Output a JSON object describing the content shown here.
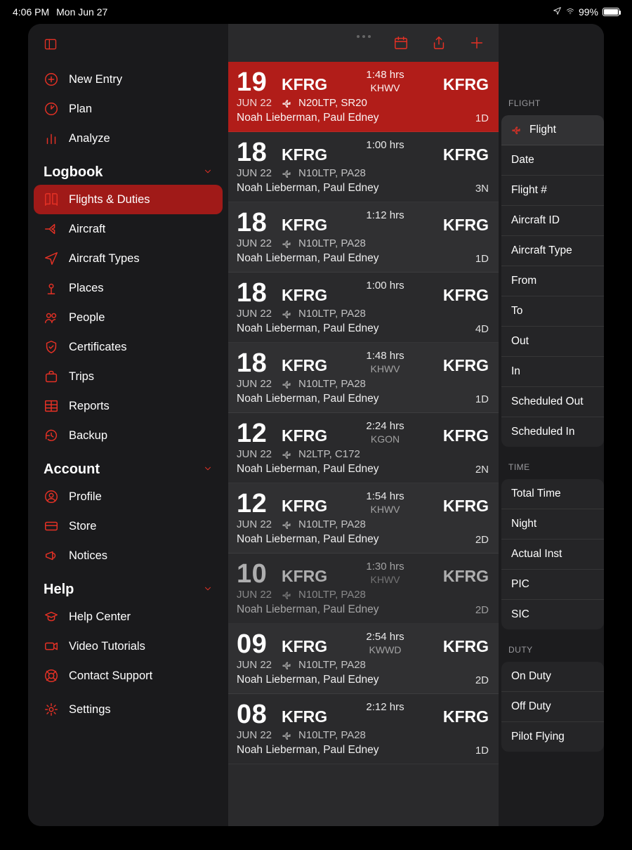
{
  "status": {
    "time": "4:06 PM",
    "date": "Mon Jun 27",
    "battery_pct": "99%"
  },
  "toolbar": {
    "calendar_icon": "calendar-icon",
    "share_icon": "share-icon",
    "add_icon": "plus-icon"
  },
  "sidebar": {
    "top_items": [
      {
        "icon": "add-circle-icon",
        "label": "New Entry"
      },
      {
        "icon": "gauge-icon",
        "label": "Plan"
      },
      {
        "icon": "bars-icon",
        "label": "Analyze"
      }
    ],
    "groups": [
      {
        "title": "Logbook",
        "items": [
          {
            "icon": "book-icon",
            "label": "Flights & Duties",
            "active": true
          },
          {
            "icon": "plane-icon",
            "label": "Aircraft"
          },
          {
            "icon": "paperplane-icon",
            "label": "Aircraft Types"
          },
          {
            "icon": "pin-icon",
            "label": "Places"
          },
          {
            "icon": "people-icon",
            "label": "People"
          },
          {
            "icon": "badge-icon",
            "label": "Certificates"
          },
          {
            "icon": "briefcase-icon",
            "label": "Trips"
          },
          {
            "icon": "table-icon",
            "label": "Reports"
          },
          {
            "icon": "history-icon",
            "label": "Backup"
          }
        ]
      },
      {
        "title": "Account",
        "items": [
          {
            "icon": "profile-icon",
            "label": "Profile"
          },
          {
            "icon": "card-icon",
            "label": "Store"
          },
          {
            "icon": "megaphone-icon",
            "label": "Notices"
          }
        ]
      },
      {
        "title": "Help",
        "items": [
          {
            "icon": "graduation-icon",
            "label": "Help Center"
          },
          {
            "icon": "video-icon",
            "label": "Video Tutorials"
          },
          {
            "icon": "lifebuoy-icon",
            "label": "Contact Support"
          }
        ]
      }
    ],
    "footer": [
      {
        "icon": "gear-icon",
        "label": "Settings"
      }
    ]
  },
  "flights": [
    {
      "day": "19",
      "month": "JUN 22",
      "origin": "KFRG",
      "dest": "KFRG",
      "duration": "1:48 hrs",
      "via": "KHWV",
      "aircraft": "N20LTP, SR20",
      "crew": "Noah Lieberman, Paul Edney",
      "tag": "1D",
      "selected": true
    },
    {
      "day": "18",
      "month": "JUN 22",
      "origin": "KFRG",
      "dest": "KFRG",
      "duration": "1:00 hrs",
      "via": "",
      "aircraft": "N10LTP, PA28",
      "crew": "Noah Lieberman, Paul Edney",
      "tag": "3N"
    },
    {
      "day": "18",
      "month": "JUN 22",
      "origin": "KFRG",
      "dest": "KFRG",
      "duration": "1:12 hrs",
      "via": "",
      "aircraft": "N10LTP, PA28",
      "crew": "Noah Lieberman, Paul Edney",
      "tag": "1D"
    },
    {
      "day": "18",
      "month": "JUN 22",
      "origin": "KFRG",
      "dest": "KFRG",
      "duration": "1:00 hrs",
      "via": "",
      "aircraft": "N10LTP, PA28",
      "crew": "Noah Lieberman, Paul Edney",
      "tag": "4D"
    },
    {
      "day": "18",
      "month": "JUN 22",
      "origin": "KFRG",
      "dest": "KFRG",
      "duration": "1:48 hrs",
      "via": "KHWV",
      "aircraft": "N10LTP, PA28",
      "crew": "Noah Lieberman, Paul Edney",
      "tag": "1D"
    },
    {
      "day": "12",
      "month": "JUN 22",
      "origin": "KFRG",
      "dest": "KFRG",
      "duration": "2:24 hrs",
      "via": "KGON",
      "aircraft": "N2LTP, C172",
      "crew": "Noah Lieberman, Paul Edney",
      "tag": "2N"
    },
    {
      "day": "12",
      "month": "JUN 22",
      "origin": "KFRG",
      "dest": "KFRG",
      "duration": "1:54 hrs",
      "via": "KHWV",
      "aircraft": "N10LTP, PA28",
      "crew": "Noah Lieberman, Paul Edney",
      "tag": "2D"
    },
    {
      "day": "10",
      "month": "JUN 22",
      "origin": "KFRG",
      "dest": "KFRG",
      "duration": "1:30 hrs",
      "via": "KHWV",
      "aircraft": "N10LTP, PA28",
      "crew": "Noah Lieberman, Paul Edney",
      "tag": "2D",
      "dim": true
    },
    {
      "day": "09",
      "month": "JUN 22",
      "origin": "KFRG",
      "dest": "KFRG",
      "duration": "2:54 hrs",
      "via": "KWWD",
      "aircraft": "N10LTP, PA28",
      "crew": "Noah Lieberman, Paul Edney",
      "tag": "2D"
    },
    {
      "day": "08",
      "month": "JUN 22",
      "origin": "KFRG",
      "dest": "KFRG",
      "duration": "2:12 hrs",
      "via": "",
      "aircraft": "N10LTP, PA28",
      "crew": "Noah Lieberman, Paul Edney",
      "tag": "1D"
    }
  ],
  "detail": {
    "groups": [
      {
        "title": "FLIGHT",
        "rows": [
          {
            "label": "Flight",
            "active": true,
            "icon": true
          },
          {
            "label": "Date"
          },
          {
            "label": "Flight #"
          },
          {
            "label": "Aircraft ID"
          },
          {
            "label": "Aircraft Type"
          },
          {
            "label": "From"
          },
          {
            "label": "To"
          },
          {
            "label": "Out"
          },
          {
            "label": "In"
          },
          {
            "label": "Scheduled Out"
          },
          {
            "label": "Scheduled In"
          }
        ]
      },
      {
        "title": "TIME",
        "rows": [
          {
            "label": "Total Time"
          },
          {
            "label": "Night"
          },
          {
            "label": "Actual Inst"
          },
          {
            "label": "PIC"
          },
          {
            "label": "SIC"
          }
        ]
      },
      {
        "title": "DUTY",
        "rows": [
          {
            "label": "On Duty"
          },
          {
            "label": "Off Duty"
          },
          {
            "label": "Pilot Flying"
          }
        ]
      }
    ]
  }
}
